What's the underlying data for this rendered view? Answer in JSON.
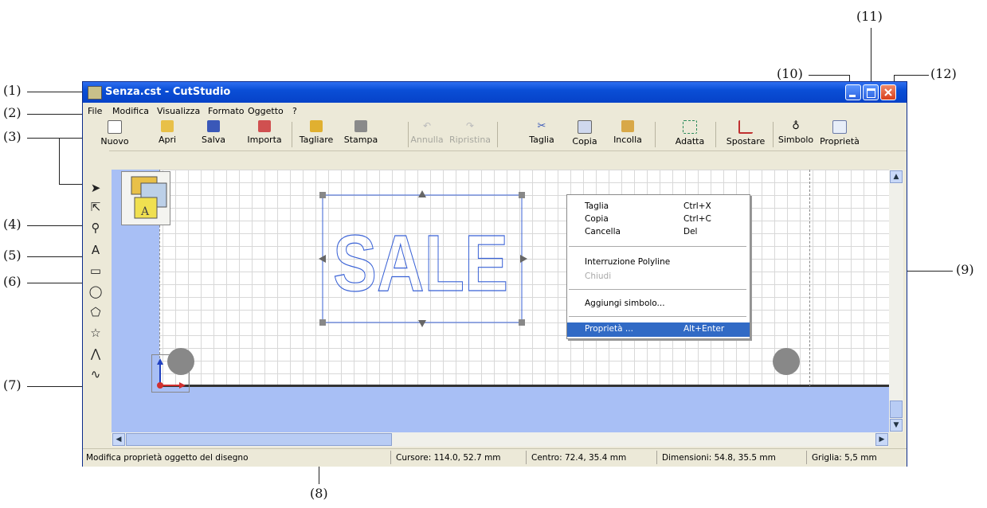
{
  "callouts": [
    "(1)",
    "(2)",
    "(3)",
    "(4)",
    "(5)",
    "(6)",
    "(7)",
    "(8)",
    "(9)",
    "(10)",
    "(11)",
    "(12)"
  ],
  "window": {
    "title": "Senza.cst - CutStudio"
  },
  "menu": [
    "File",
    "Modifica",
    "Visualizza",
    "Formato",
    "Oggetto",
    "?"
  ],
  "toolbar": [
    {
      "label": "Nuovo",
      "icon": "new-file-icon"
    },
    {
      "label": "Apri",
      "icon": "open-folder-icon"
    },
    {
      "label": "Salva",
      "icon": "save-disk-icon"
    },
    {
      "label": "Importa",
      "icon": "import-icon"
    },
    {
      "label": "Tagliare",
      "icon": "cutting-icon"
    },
    {
      "label": "Stampa",
      "icon": "printer-icon"
    },
    {
      "label": "Annulla",
      "icon": "undo-icon",
      "disabled": true
    },
    {
      "label": "Ripristina",
      "icon": "redo-icon",
      "disabled": true
    },
    {
      "label": "Taglia",
      "icon": "scissors-icon"
    },
    {
      "label": "Copia",
      "icon": "copy-icon"
    },
    {
      "label": "Incolla",
      "icon": "paste-icon"
    },
    {
      "label": "Adatta",
      "icon": "fit-icon"
    },
    {
      "label": "Spostare",
      "icon": "move-icon"
    },
    {
      "label": "Simbolo",
      "icon": "symbol-icon"
    },
    {
      "label": "Proprietà",
      "icon": "properties-icon"
    }
  ],
  "tools": [
    {
      "name": "select-arrow-icon",
      "glyph": "➤"
    },
    {
      "name": "node-edit-icon",
      "glyph": "⇱"
    },
    {
      "name": "zoom-icon",
      "glyph": "⚲"
    },
    {
      "name": "text-tool-icon",
      "glyph": "A"
    },
    {
      "name": "rectangle-tool-icon",
      "glyph": "▭"
    },
    {
      "name": "ellipse-tool-icon",
      "glyph": "◯"
    },
    {
      "name": "polygon-tool-icon",
      "glyph": "⬠"
    },
    {
      "name": "star-tool-icon",
      "glyph": "☆"
    },
    {
      "name": "polyline-tool-icon",
      "glyph": "⋀"
    },
    {
      "name": "curve-tool-icon",
      "glyph": "∿"
    }
  ],
  "artwork": {
    "text": "SALE",
    "outline_color": "#3a62d6"
  },
  "context_menu": {
    "items": [
      {
        "label": "Taglia",
        "shortcut": "Ctrl+X"
      },
      {
        "label": "Copia",
        "shortcut": "Ctrl+C"
      },
      {
        "label": "Cancella",
        "shortcut": "Del"
      },
      {
        "label": "Interruzione Polyline",
        "shortcut": ""
      },
      {
        "label": "Chiudi",
        "shortcut": "",
        "disabled": true
      },
      {
        "label": "Aggiungi simbolo...",
        "shortcut": ""
      },
      {
        "label": "Proprietà ...",
        "shortcut": "Alt+Enter",
        "selected": true
      }
    ]
  },
  "status": {
    "message": "Modifica proprietà oggetto del disegno",
    "cursor": "Cursore: 114.0, 52.7 mm",
    "center": "Centro: 72.4, 35.4 mm",
    "dimensions": "Dimensioni: 54.8, 35.5 mm",
    "grid": "Griglia: 5,5 mm"
  },
  "colors": {
    "titlebar": "#0a4ed6",
    "selection": "#316ac5",
    "media_area": "#a8bff5"
  }
}
